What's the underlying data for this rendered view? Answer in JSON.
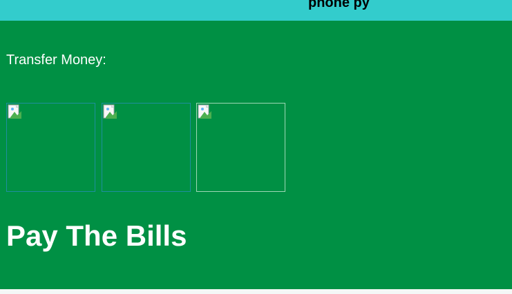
{
  "header": {
    "brand": "phone py",
    "background_color": "#33cccc"
  },
  "main": {
    "background_color": "#009044",
    "transfer_label": "Transfer Money:",
    "transfer_options": [
      {
        "icon": "broken-image-icon"
      },
      {
        "icon": "broken-image-icon"
      },
      {
        "icon": "broken-image-icon"
      }
    ],
    "bills_heading": "Pay The Bills"
  }
}
